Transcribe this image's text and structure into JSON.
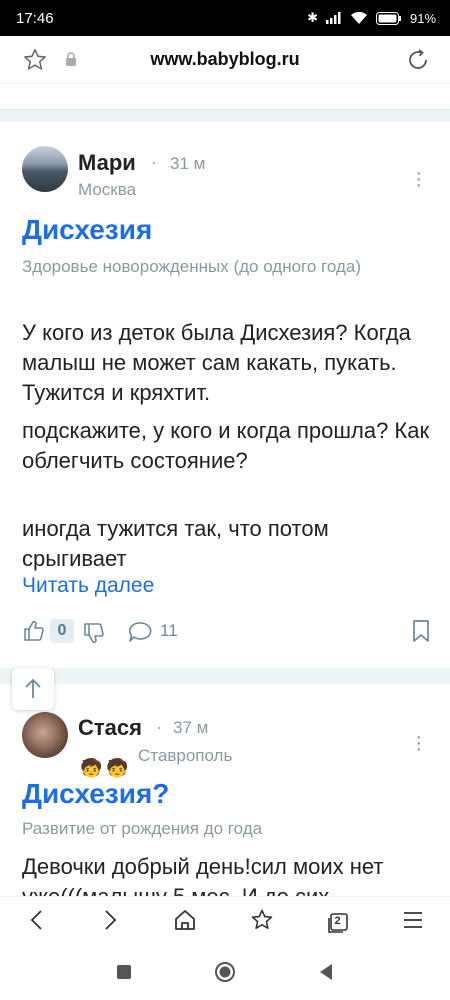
{
  "status_bar": {
    "time": "17:46",
    "battery": "91"
  },
  "browser": {
    "url": "www.babyblog.ru"
  },
  "posts": [
    {
      "author": "Мари",
      "time": "31 м",
      "city": "Москва",
      "title": "Дисхезия",
      "category": "Здоровье новорожденных (до одного года)",
      "paragraphs": [
        "У кого из деток была Дисхезия? Когда малыш не может сам какать, пукать. Тужится и кряхтит.",
        "подскажите, у кого и когда прошла? Как облегчить состояние?",
        "иногда тужится так, что потом срыгивает"
      ],
      "read_more": "Читать далее",
      "likes": "0",
      "comments": "11"
    },
    {
      "author": "Стася",
      "time": "37 м",
      "city": "Ставрополь",
      "badges": [
        "🧒",
        "🧒"
      ],
      "title": "Дисхезия?",
      "category": "Развитие от рождения до года",
      "paragraphs": [
        "Девочки добрый день!сил моих нет уже(((малышу 5 мес. И до сих"
      ]
    }
  ],
  "icons": {
    "bookmark_star": "star-icon",
    "lock": "lock-icon",
    "reload": "reload-icon"
  },
  "bottom_nav": {
    "tabs_count": "2"
  },
  "colors": {
    "accent": "#1b6ee6",
    "muted": "#8a9aa0",
    "feed_bg": "#eef5f6"
  }
}
